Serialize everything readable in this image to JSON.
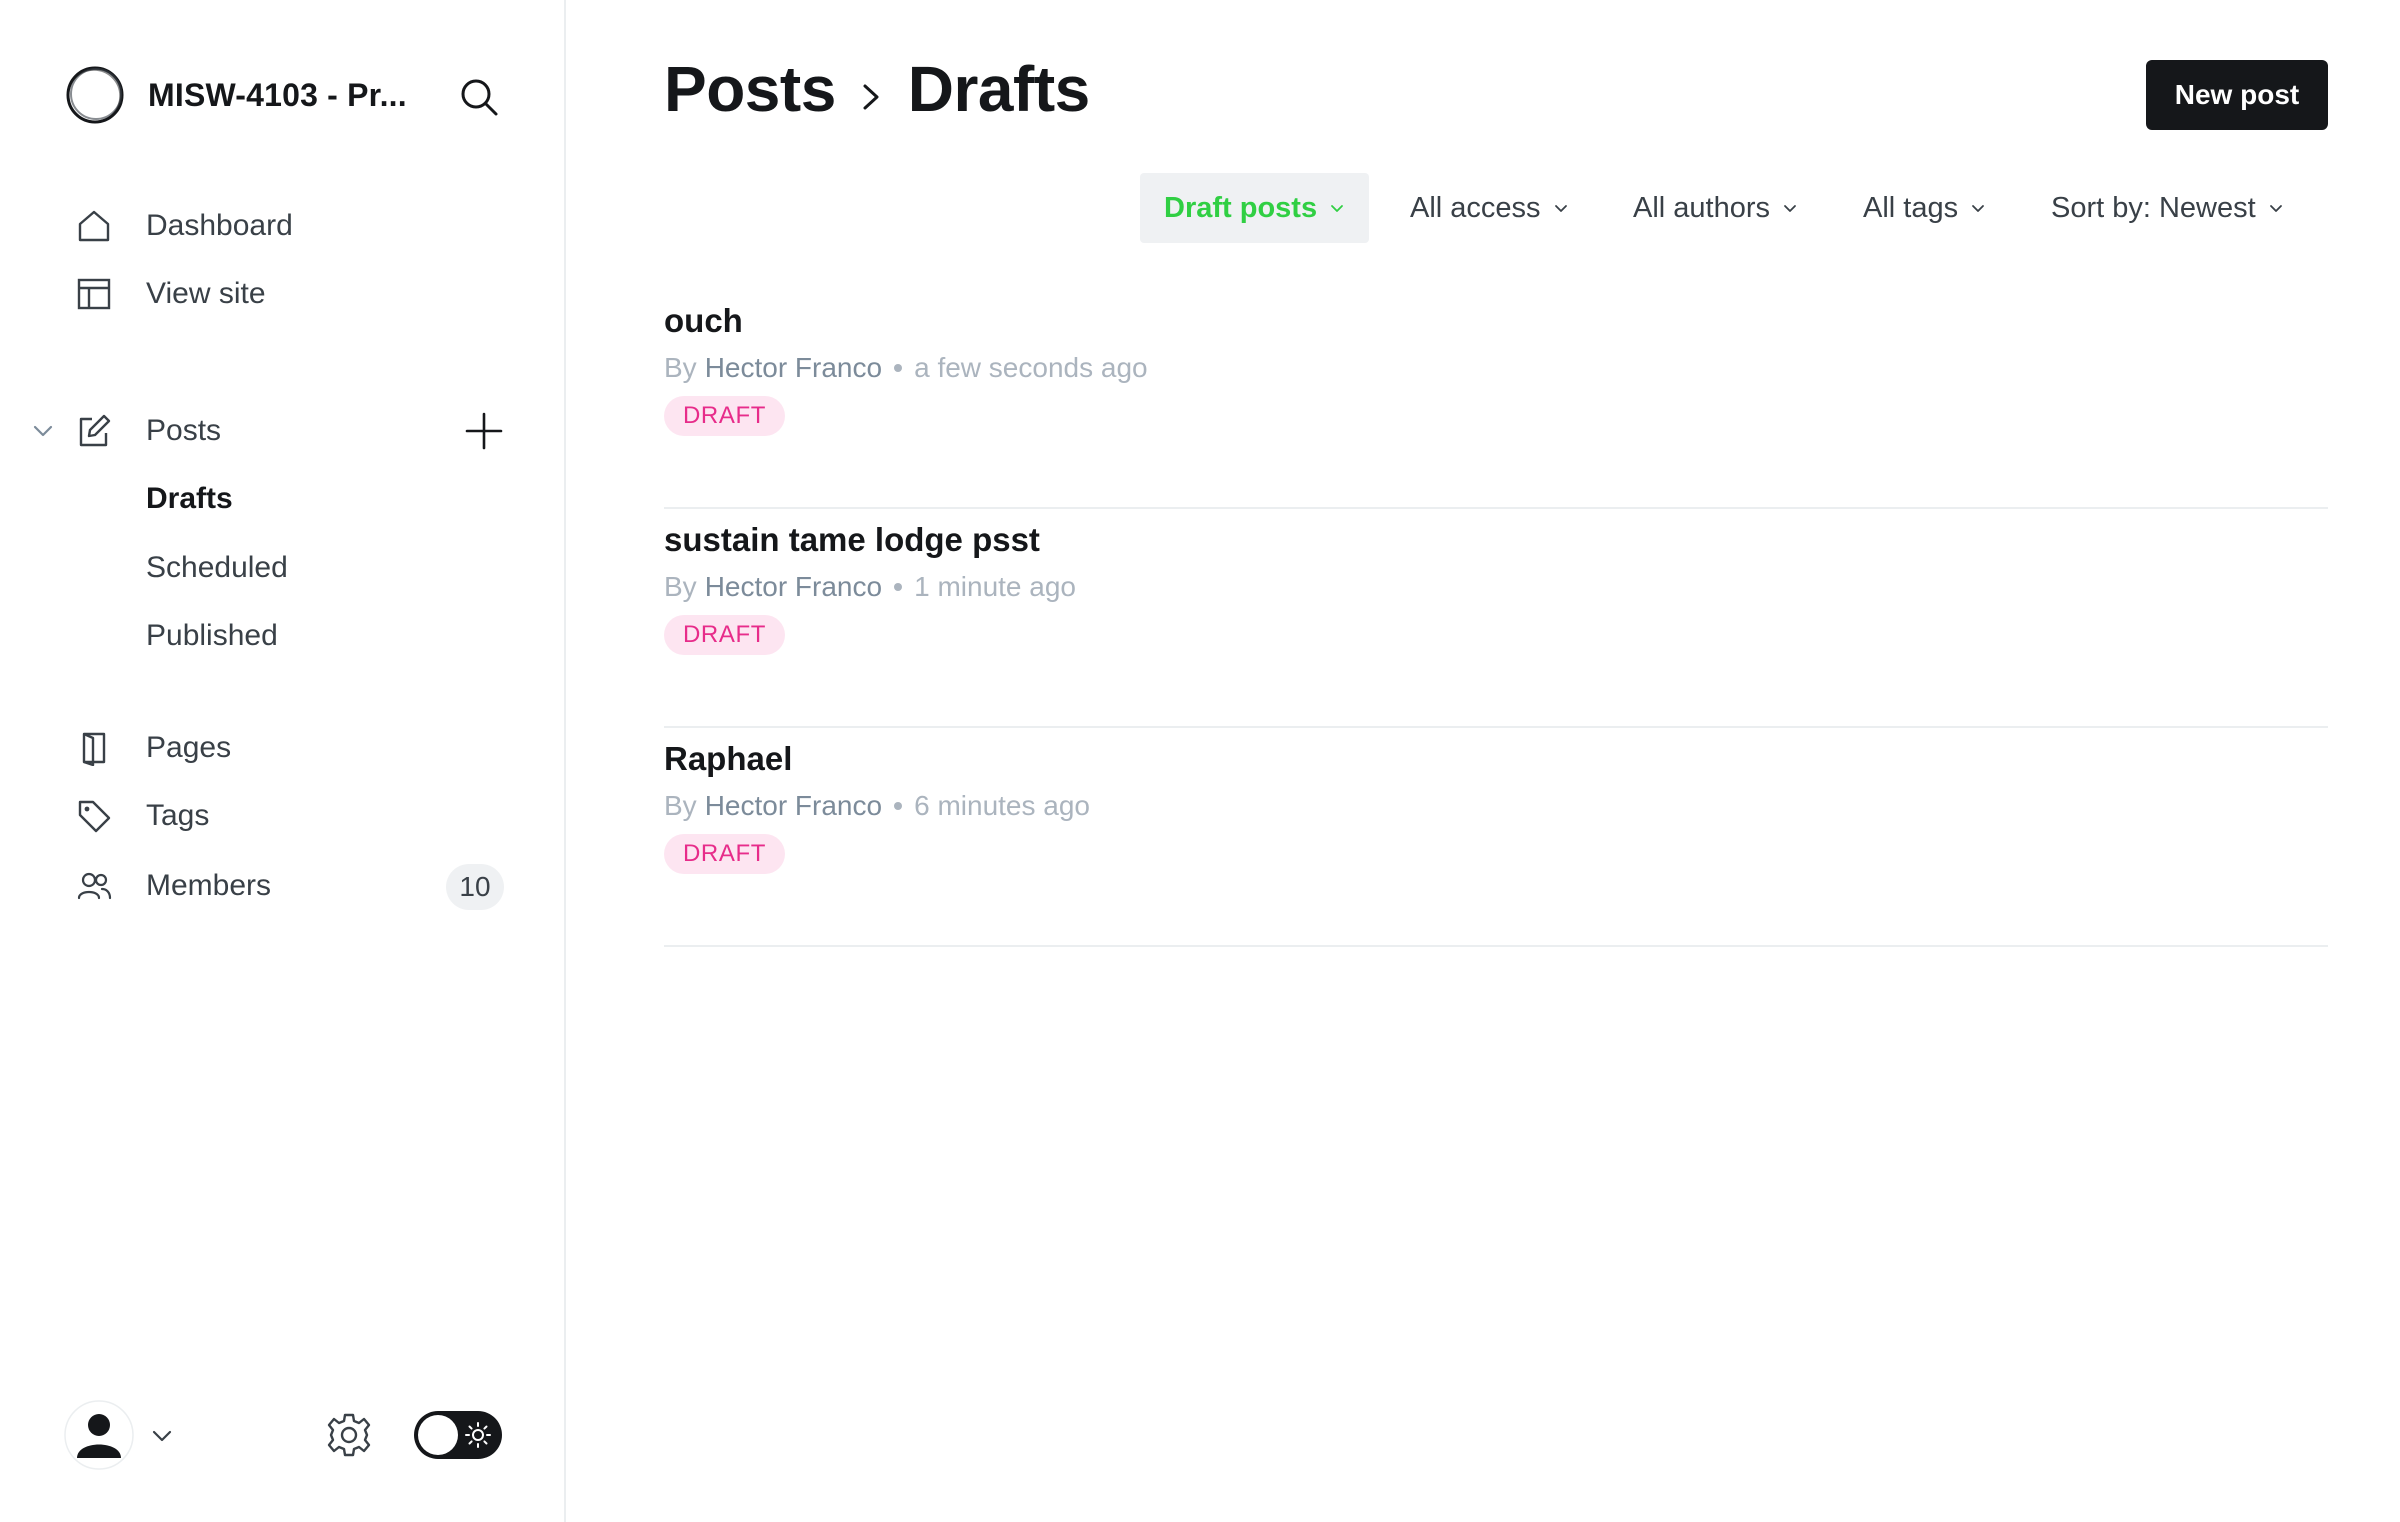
{
  "sidebar": {
    "site_title": "MISW-4103 - Pr...",
    "nav": {
      "dashboard": "Dashboard",
      "view_site": "View site",
      "posts": "Posts",
      "pages": "Pages",
      "tags": "Tags",
      "members": "Members"
    },
    "posts_sub": {
      "drafts": "Drafts",
      "scheduled": "Scheduled",
      "published": "Published"
    },
    "members_count": "10",
    "icons": [
      "logo-icon",
      "search-icon",
      "home-icon",
      "layout-icon",
      "chevron-down-icon",
      "edit-icon",
      "plus-icon",
      "page-icon",
      "tag-icon",
      "members-icon",
      "avatar",
      "gear-icon",
      "sun-icon"
    ]
  },
  "header": {
    "breadcrumb_parent": "Posts",
    "breadcrumb_current": "Drafts",
    "new_post_label": "New post"
  },
  "filters": {
    "type": "Draft posts",
    "access": "All access",
    "authors": "All authors",
    "tags": "All tags",
    "sort": "Sort by: Newest"
  },
  "posts": [
    {
      "title": "ouch",
      "by": "By",
      "author": "Hector Franco",
      "time": "a few seconds ago",
      "status": "DRAFT"
    },
    {
      "title": "sustain tame lodge psst",
      "by": "By",
      "author": "Hector Franco",
      "time": "1 minute ago",
      "status": "DRAFT"
    },
    {
      "title": "Raphael",
      "by": "By",
      "author": "Hector Franco",
      "time": "6 minutes ago",
      "status": "DRAFT"
    }
  ],
  "colors": {
    "accent_green": "#30cf43",
    "draft_pink": "#e72c8a",
    "draft_bg": "#fde5f1",
    "text_dark": "#15171a",
    "muted": "#abb4be"
  }
}
